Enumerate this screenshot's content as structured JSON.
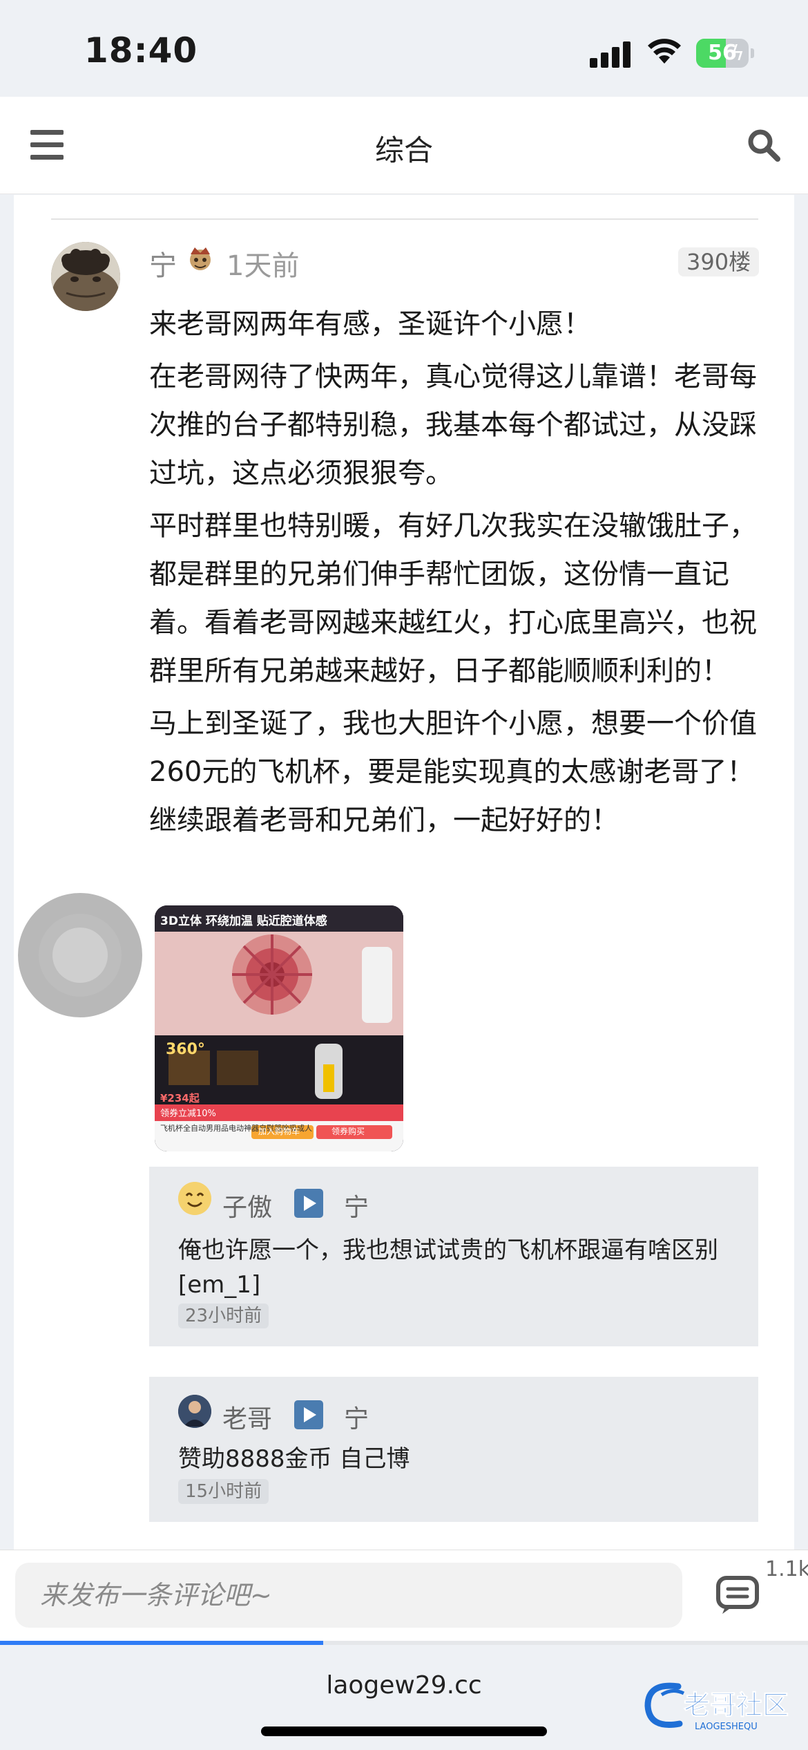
{
  "status_bar": {
    "time": "18:40",
    "battery": "56",
    "battery_level": 0.56
  },
  "nav": {
    "title": "综合",
    "menu_icon": "menu-icon",
    "search_icon": "search-icon"
  },
  "post": {
    "author": "宁",
    "time": "1天前",
    "floor": "390楼",
    "paragraphs": [
      "来老哥网两年有感，圣诞许个小愿！",
      "在老哥网待了快两年，真心觉得这儿靠谱！老哥每次推的台子都特别稳，我基本每个都试过，从没踩过坑，这点必须狠狠夸。",
      "平时群里也特别暖，有好几次我实在没辙饿肚子，都是群里的兄弟们伸手帮忙团饭，这份情一直记着。看着老哥网越来越红火，打心底里高兴，也祝群里所有兄弟越来越好，日子都能顺顺利利的！",
      "马上到圣诞了，我也大胆许个小愿，想要一个价值260元的飞机杯，要是能实现真的太感谢老哥了！继续跟着老哥和兄弟们，一起好好的！"
    ],
    "image": {
      "texts": {
        "header": "3D立体 环绕加温 贴近腔道体感",
        "temp": "360°",
        "price": "¥234起",
        "promo": "领券立减10%",
        "title": "飞机杯全自动男用品电动神器自慰器吮吸成人",
        "cart": "加入购物车",
        "buy": "领券购买"
      }
    }
  },
  "replies": [
    {
      "name": "子傲",
      "to": "宁",
      "text": "俺也许愿一个，我也想试试贵的飞机杯跟逼有啥区别[em_1]",
      "time": "23小时前"
    },
    {
      "name": "老哥",
      "to": "宁",
      "text": "赞助8888金币 自己博",
      "time": "15小时前"
    }
  ],
  "comment_bar": {
    "placeholder": "来发布一条评论吧~",
    "count": "1.1k"
  },
  "address_bar": {
    "url": "laogew29.cc",
    "load_progress": 0.4
  },
  "brand": {
    "name": "老哥社区",
    "sub": "LAOGESHEQU"
  }
}
